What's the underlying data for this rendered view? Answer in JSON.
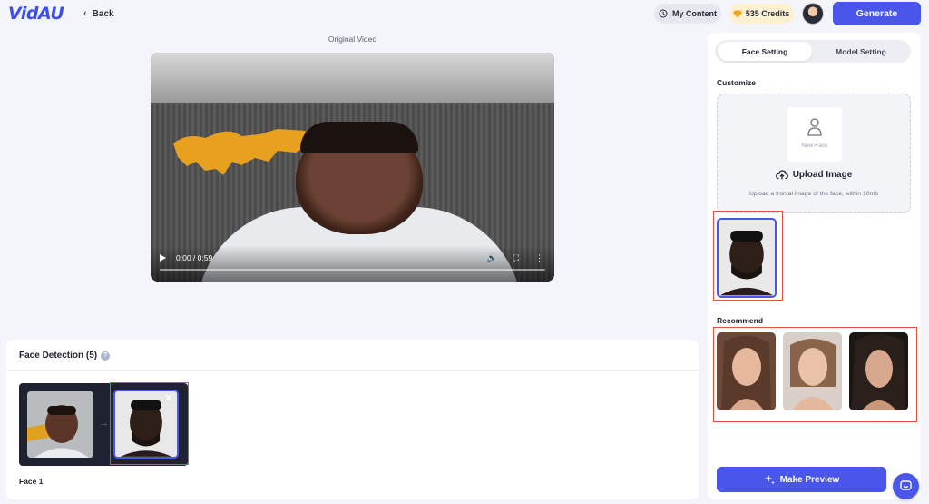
{
  "header": {
    "logo_text": "VidAU",
    "back_label": "Back",
    "my_content_label": "My Content",
    "credits_label": "535 Credits",
    "generate_label": "Generate"
  },
  "video": {
    "title": "Original Video",
    "time": "0:00 / 0:59"
  },
  "face_detection": {
    "title": "Face Detection (5)",
    "faces": [
      {
        "label": "Face 1"
      }
    ]
  },
  "right_panel": {
    "tabs": [
      {
        "label": "Face Setting",
        "active": true
      },
      {
        "label": "Model Setting",
        "active": false
      }
    ],
    "customize_label": "Customize",
    "new_face_label": "New Face",
    "upload_label": "Upload Image",
    "upload_note": "Upload a frontal image of the face, within 10mb",
    "recommend_label": "Recommend",
    "make_preview_label": "Make Preview"
  },
  "colors": {
    "accent": "#4a55ea",
    "highlight": "#e2523f",
    "credits_bg": "#fdf1d2"
  }
}
